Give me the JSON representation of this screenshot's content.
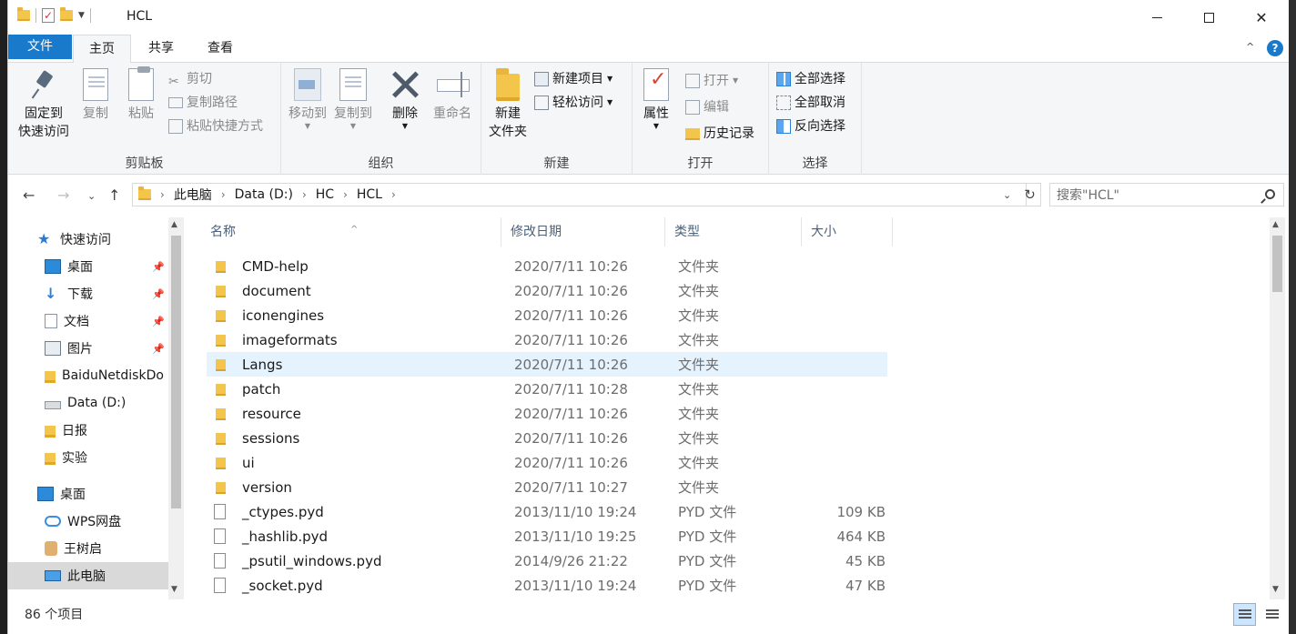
{
  "window": {
    "title": "HCL"
  },
  "tabs": {
    "file": "文件",
    "home": "主页",
    "share": "共享",
    "view": "查看"
  },
  "ribbon": {
    "clipboard": {
      "pin": "固定到\n快速访问",
      "copy": "复制",
      "paste": "粘贴",
      "cut": "剪切",
      "copy_path": "复制路径",
      "paste_shortcut": "粘贴快捷方式",
      "label": "剪贴板"
    },
    "organize": {
      "move_to": "移动到",
      "copy_to": "复制到",
      "delete": "删除",
      "rename": "重命名",
      "label": "组织"
    },
    "new": {
      "new_folder": "新建\n文件夹",
      "new_item": "新建项目",
      "easy_access": "轻松访问",
      "label": "新建"
    },
    "open": {
      "properties": "属性",
      "open": "打开",
      "edit": "编辑",
      "history": "历史记录",
      "label": "打开"
    },
    "select": {
      "select_all": "全部选择",
      "select_none": "全部取消",
      "invert": "反向选择",
      "label": "选择"
    }
  },
  "address": {
    "segments": [
      "此电脑",
      "Data (D:)",
      "HC",
      "HCL"
    ],
    "search_placeholder": "搜索\"HCL\""
  },
  "navpane": {
    "items": [
      {
        "label": "快速访问",
        "icon": "star-icon"
      },
      {
        "label": "桌面",
        "icon": "desktop-icon",
        "pinned": true
      },
      {
        "label": "下载",
        "icon": "download-icon",
        "pinned": true
      },
      {
        "label": "文档",
        "icon": "document-icon",
        "pinned": true
      },
      {
        "label": "图片",
        "icon": "pictures-icon",
        "pinned": true
      },
      {
        "label": "BaiduNetdiskDo",
        "icon": "folder-icon"
      },
      {
        "label": "Data (D:)",
        "icon": "drive-icon"
      },
      {
        "label": "日报",
        "icon": "folder-icon"
      },
      {
        "label": "实验",
        "icon": "folder-icon"
      },
      {
        "label": "桌面",
        "icon": "desktop-icon"
      },
      {
        "label": "WPS网盘",
        "icon": "cloud-icon"
      },
      {
        "label": "王树启",
        "icon": "user-icon"
      },
      {
        "label": "此电脑",
        "icon": "pc-icon",
        "selected": true
      }
    ]
  },
  "columns": {
    "name": "名称",
    "date": "修改日期",
    "type": "类型",
    "size": "大小"
  },
  "files": [
    {
      "name": "CMD-help",
      "date": "2020/7/11 10:26",
      "type": "文件夹",
      "size": "",
      "kind": "folder"
    },
    {
      "name": "document",
      "date": "2020/7/11 10:26",
      "type": "文件夹",
      "size": "",
      "kind": "folder"
    },
    {
      "name": "iconengines",
      "date": "2020/7/11 10:26",
      "type": "文件夹",
      "size": "",
      "kind": "folder"
    },
    {
      "name": "imageformats",
      "date": "2020/7/11 10:26",
      "type": "文件夹",
      "size": "",
      "kind": "folder"
    },
    {
      "name": "Langs",
      "date": "2020/7/11 10:26",
      "type": "文件夹",
      "size": "",
      "kind": "folder",
      "selected": true
    },
    {
      "name": "patch",
      "date": "2020/7/11 10:28",
      "type": "文件夹",
      "size": "",
      "kind": "folder"
    },
    {
      "name": "resource",
      "date": "2020/7/11 10:26",
      "type": "文件夹",
      "size": "",
      "kind": "folder"
    },
    {
      "name": "sessions",
      "date": "2020/7/11 10:26",
      "type": "文件夹",
      "size": "",
      "kind": "folder"
    },
    {
      "name": "ui",
      "date": "2020/7/11 10:26",
      "type": "文件夹",
      "size": "",
      "kind": "folder"
    },
    {
      "name": "version",
      "date": "2020/7/11 10:27",
      "type": "文件夹",
      "size": "",
      "kind": "folder"
    },
    {
      "name": "_ctypes.pyd",
      "date": "2013/11/10 19:24",
      "type": "PYD 文件",
      "size": "109 KB",
      "kind": "file"
    },
    {
      "name": "_hashlib.pyd",
      "date": "2013/11/10 19:25",
      "type": "PYD 文件",
      "size": "464 KB",
      "kind": "file"
    },
    {
      "name": "_psutil_windows.pyd",
      "date": "2014/9/26 21:22",
      "type": "PYD 文件",
      "size": "45 KB",
      "kind": "file"
    },
    {
      "name": "_socket.pyd",
      "date": "2013/11/10 19:24",
      "type": "PYD 文件",
      "size": "47 KB",
      "kind": "file"
    }
  ],
  "status": {
    "count": "86 个项目"
  }
}
